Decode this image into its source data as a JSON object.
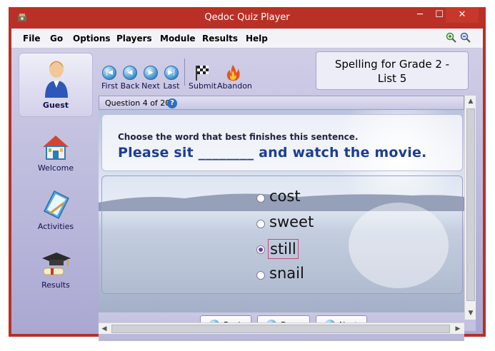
{
  "window": {
    "title": "Qedoc Quiz Player",
    "controls": {
      "minimize": "─",
      "maximize": "☐",
      "close": "✕"
    },
    "colors": {
      "frame": "#b93026",
      "accent": "#1d3c95"
    }
  },
  "menu": {
    "items": [
      "File",
      "Go",
      "Options",
      "Players",
      "Module",
      "Results",
      "Help"
    ]
  },
  "zoom": {
    "in_icon": "zoom-in-icon",
    "out_icon": "zoom-out-icon"
  },
  "sidebar": {
    "user": "Guest",
    "items": [
      {
        "label": "Welcome",
        "icon": "welcome-house-icon"
      },
      {
        "label": "Activities",
        "icon": "activities-book-icon"
      },
      {
        "label": "Results",
        "icon": "results-graduation-icon"
      }
    ]
  },
  "toolbar": {
    "first": "First",
    "back": "Back",
    "next": "Next",
    "last": "Last",
    "submit": "Submit",
    "abandon": "Abandon"
  },
  "quiz": {
    "title_line1": "Spelling for Grade 2 -",
    "title_line2": "List 5",
    "counter": "Question 4 of 20.",
    "instruction": "Choose the word that best finishes this sentence.",
    "sentence": "Please sit ________ and watch the movie.",
    "options": [
      "cost",
      "sweet",
      "still",
      "snail"
    ],
    "selected_index": 2
  },
  "nav": {
    "back": "Back",
    "done": "Done",
    "next": "Next"
  }
}
